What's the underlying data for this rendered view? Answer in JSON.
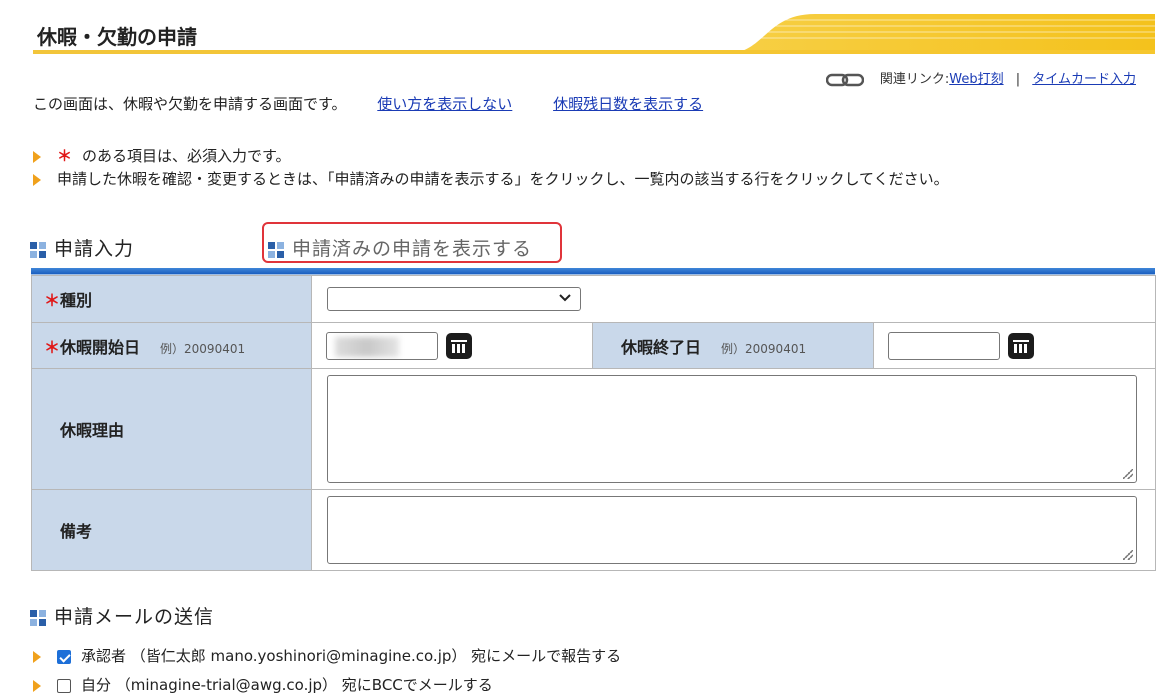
{
  "header": {
    "title": "休暇・欠勤の申請"
  },
  "top_links": {
    "label": "関連リンク:",
    "web_punch": "Web打刻",
    "separator": "|",
    "timecard": "タイムカード入力"
  },
  "intro": {
    "text": "この画面は、休暇や欠勤を申請する画面です。",
    "hide_usage": "使い方を表示しない",
    "show_remaining": "休暇残日数を表示する"
  },
  "notes": [
    {
      "star": "＊",
      "text": "のある項目は、必須入力です。"
    },
    {
      "text": "申請した休暇を確認・変更するときは、「申請済みの申請を表示する」をクリックし、一覧内の該当する行をクリックしてください。"
    }
  ],
  "sections": {
    "input": "申請入力",
    "submitted": "申請済みの申請を表示する",
    "mail": "申請メールの送信"
  },
  "form": {
    "type_label": "種別",
    "type_value": "",
    "start_label": "休暇開始日",
    "start_example": "例）20090401",
    "end_label": "休暇終了日",
    "end_example": "例）20090401",
    "end_value": "",
    "reason_label": "休暇理由",
    "remarks_label": "備考",
    "required_star": "＊"
  },
  "mail": [
    {
      "checked": true,
      "text": "承認者 （皆仁太郎 mano.yoshinori@minagine.co.jp） 宛にメールで報告する"
    },
    {
      "checked": false,
      "text": "自分 （minagine-trial@awg.co.jp） 宛にBCCでメールする"
    }
  ],
  "colors": {
    "accent_yellow": "#f5c62f",
    "link": "#1a3bb5",
    "label_bg": "#c9d8ea",
    "required": "#e01818",
    "highlight_border": "#e0343a"
  },
  "icons": [
    "link-chain-icon",
    "bullet-arrow-icon",
    "section-grid-icon",
    "calendar-icon",
    "chevron-down-icon",
    "checkbox-icon"
  ]
}
